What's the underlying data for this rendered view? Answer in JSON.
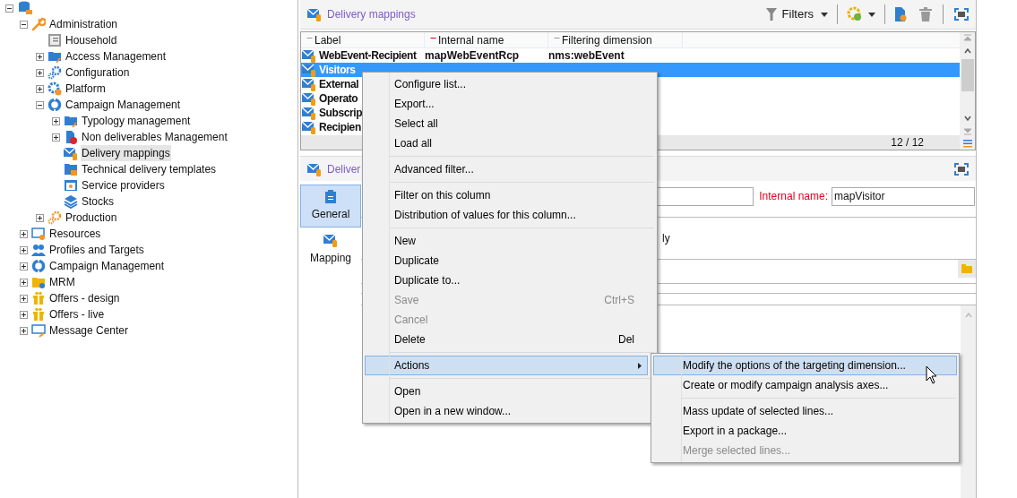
{
  "tree": [
    {
      "label": "Administration",
      "kind": "wrench",
      "expanded": true,
      "selected": false,
      "children": [
        {
          "label": "Household",
          "kind": "form",
          "selected": false
        },
        {
          "label": "Access Management",
          "kind": "folder-key",
          "expanded": false,
          "selected": false
        },
        {
          "label": "Configuration",
          "kind": "gears",
          "expanded": false,
          "selected": false
        },
        {
          "label": "Platform",
          "kind": "gear-globe",
          "expanded": false,
          "selected": false
        },
        {
          "label": "Campaign Management",
          "kind": "ring",
          "expanded": true,
          "selected": false,
          "children": [
            {
              "label": "Typology management",
              "kind": "folder-key",
              "expanded": false,
              "selected": false
            },
            {
              "label": "Non deliverables Management",
              "kind": "doc-error",
              "expanded": false,
              "selected": false
            },
            {
              "label": "Delivery mappings",
              "kind": "mail-db",
              "selected": true
            },
            {
              "label": "Technical delivery templates",
              "kind": "folder-mail",
              "selected": false
            },
            {
              "label": "Service providers",
              "kind": "service",
              "selected": false
            },
            {
              "label": "Stocks",
              "kind": "stack",
              "selected": false
            }
          ]
        },
        {
          "label": "Production",
          "kind": "gears-orange",
          "expanded": false,
          "selected": false
        }
      ]
    },
    {
      "label": "Resources",
      "kind": "screen-gear",
      "expanded": false,
      "selected": false
    },
    {
      "label": "Profiles and Targets",
      "kind": "people",
      "expanded": false,
      "selected": false
    },
    {
      "label": "Campaign Management",
      "kind": "ring",
      "expanded": false,
      "selected": false
    },
    {
      "label": "MRM",
      "kind": "folder-gear",
      "expanded": false,
      "selected": false
    },
    {
      "label": "Offers - design",
      "kind": "gift",
      "expanded": false,
      "selected": false
    },
    {
      "label": "Offers - live",
      "kind": "gift",
      "expanded": false,
      "selected": false
    },
    {
      "label": "Message Center",
      "kind": "monitor-wrench",
      "expanded": false,
      "selected": false
    }
  ],
  "list_panel": {
    "title": "Delivery mappings",
    "filters": "Filters",
    "columns": [
      "Label",
      "Internal name",
      "Filtering dimension"
    ],
    "rows": [
      {
        "cells": [
          "WebEvent-Recipient",
          "mapWebEventRcp",
          "nms:webEvent"
        ],
        "selected": false
      },
      {
        "cells": [
          "Visitors"
        ],
        "selected": true
      },
      {
        "cells": [
          "External"
        ],
        "selected": false
      },
      {
        "cells": [
          "Operato"
        ],
        "selected": false
      },
      {
        "cells": [
          "Subscrip"
        ],
        "selected": false
      },
      {
        "cells": [
          "Recipien"
        ],
        "selected": false
      }
    ],
    "count": "12 / 12"
  },
  "detail_panel": {
    "title": "Deliver",
    "tabs": [
      {
        "label": "General",
        "selected": true
      },
      {
        "label": "Mapping",
        "selected": false
      }
    ],
    "internal_name_label": "Internal name:",
    "internal_name_value": "mapVisitor",
    "text_fragment": "ly"
  },
  "context_menu": {
    "groups": [
      [
        {
          "label": "Configure list...",
          "kind": "command",
          "disabled": false,
          "selected": false
        },
        {
          "label": "Export...",
          "kind": "command",
          "disabled": false,
          "selected": false
        },
        {
          "label": "Select all",
          "kind": "command",
          "disabled": false,
          "selected": false
        },
        {
          "label": "Load all",
          "kind": "command",
          "disabled": false,
          "selected": false
        }
      ],
      [
        {
          "label": "Advanced filter...",
          "kind": "command",
          "disabled": false,
          "selected": false
        }
      ],
      [
        {
          "label": "Filter on this column",
          "kind": "command",
          "disabled": false,
          "selected": false
        },
        {
          "label": "Distribution of values for this column...",
          "kind": "command",
          "disabled": false,
          "selected": false
        }
      ],
      [
        {
          "label": "New",
          "kind": "command",
          "disabled": false,
          "selected": false
        },
        {
          "label": "Duplicate",
          "kind": "command",
          "disabled": false,
          "selected": false
        },
        {
          "label": "Duplicate to...",
          "kind": "command",
          "disabled": false,
          "selected": false
        },
        {
          "label": "Save",
          "shortcut": "Ctrl+S",
          "kind": "command",
          "disabled": true,
          "selected": false
        },
        {
          "label": "Cancel",
          "kind": "command",
          "disabled": true,
          "selected": false
        },
        {
          "label": "Delete",
          "shortcut": "Del",
          "kind": "command",
          "disabled": false,
          "selected": false
        }
      ],
      [
        {
          "label": "Actions",
          "kind": "submenu",
          "disabled": false,
          "selected": true
        }
      ],
      [
        {
          "label": "Open",
          "kind": "command",
          "disabled": false,
          "selected": false
        },
        {
          "label": "Open in a new window...",
          "kind": "command",
          "disabled": false,
          "selected": false
        }
      ]
    ]
  },
  "submenu": {
    "groups": [
      [
        {
          "label": "Modify the options of the targeting dimension...",
          "disabled": false,
          "selected": true
        },
        {
          "label": "Create or modify campaign analysis axes...",
          "disabled": false,
          "selected": false
        }
      ],
      [
        {
          "label": "Mass update of selected lines...",
          "disabled": false,
          "selected": false
        },
        {
          "label": "Export in a package...",
          "disabled": false,
          "selected": false
        },
        {
          "label": "Merge selected lines...",
          "disabled": true,
          "selected": false
        }
      ]
    ]
  }
}
